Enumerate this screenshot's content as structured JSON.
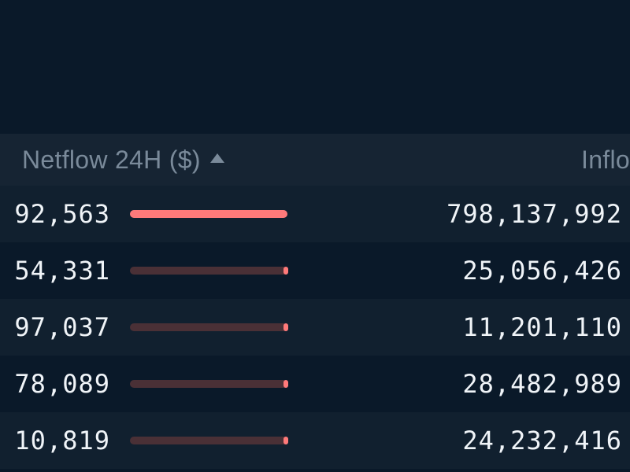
{
  "columns": {
    "netflow_label": "Netflow 24H ($)",
    "inflow_label": "Inflo",
    "sort_direction": "asc"
  },
  "rows": [
    {
      "netflow_partial": "92,563",
      "bar_full": true,
      "bar_percent": 100,
      "inflow": "798,137,992"
    },
    {
      "netflow_partial": "54,331",
      "bar_full": false,
      "bar_percent": 88,
      "inflow": "25,056,426"
    },
    {
      "netflow_partial": "97,037",
      "bar_full": false,
      "bar_percent": 95,
      "inflow": "11,201,110"
    },
    {
      "netflow_partial": "78,089",
      "bar_full": false,
      "bar_percent": 95,
      "inflow": "28,482,989"
    },
    {
      "netflow_partial": "10,819",
      "bar_full": false,
      "bar_percent": 95,
      "inflow": "24,232,416"
    }
  ]
}
